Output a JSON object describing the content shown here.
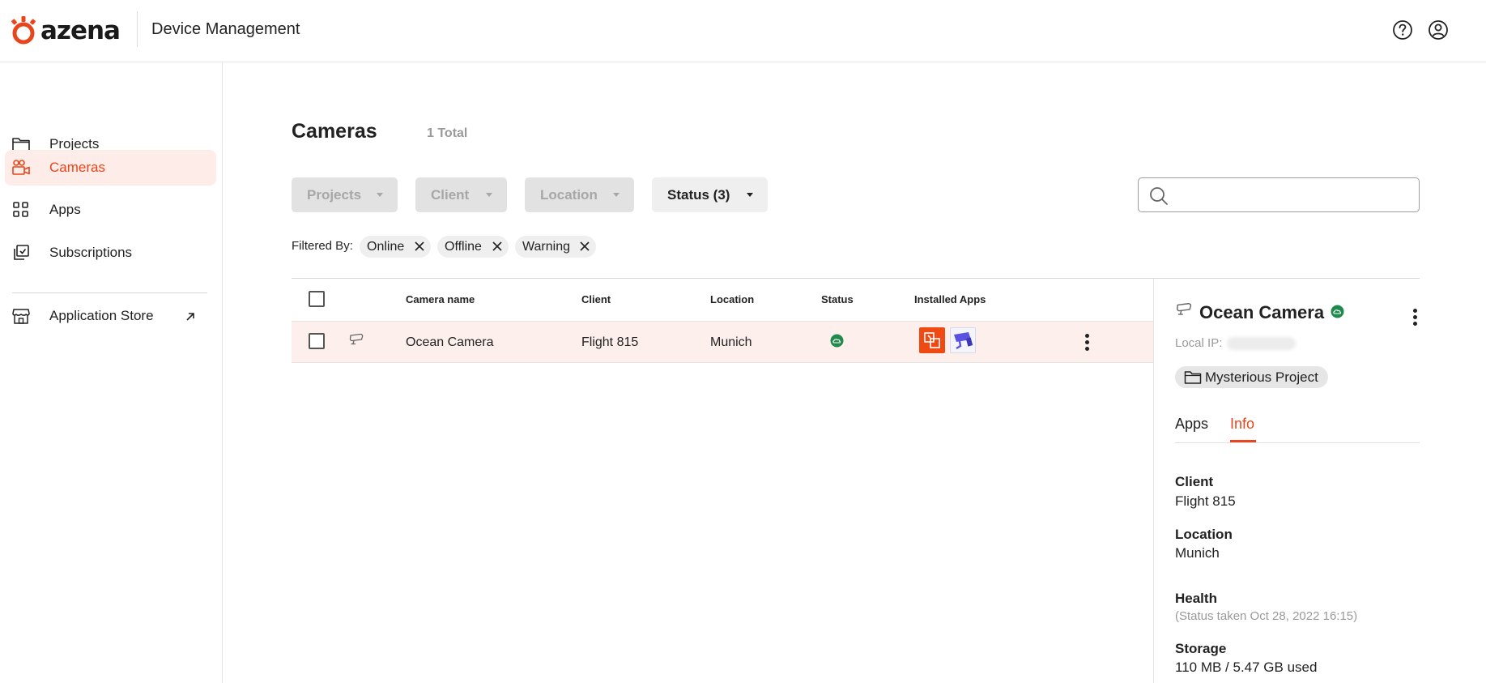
{
  "header": {
    "brand": "azena",
    "title": "Device Management",
    "help_icon": "help-circle-icon",
    "account_icon": "user-circle-icon"
  },
  "sidebar": {
    "items": [
      {
        "label": "Projects",
        "icon": "folder-icon",
        "active": false
      },
      {
        "label": "Cameras",
        "icon": "camera-icon",
        "active": true
      },
      {
        "label": "Apps",
        "icon": "grid-icon",
        "active": false
      },
      {
        "label": "Subscriptions",
        "icon": "subscriptions-icon",
        "active": false
      }
    ],
    "store": {
      "label": "Application Store",
      "icon": "store-icon",
      "external_icon": "external-arrow-icon"
    }
  },
  "main": {
    "title": "Cameras",
    "count": "1 Total",
    "filters": [
      {
        "label": "Projects",
        "enabled": false
      },
      {
        "label": "Client",
        "enabled": false
      },
      {
        "label": "Location",
        "enabled": false
      },
      {
        "label": "Status (3)",
        "enabled": true
      }
    ],
    "search": {
      "placeholder": "",
      "value": ""
    },
    "filtered_by": {
      "label": "Filtered By:",
      "chips": [
        "Online",
        "Offline",
        "Warning"
      ]
    },
    "table": {
      "columns": [
        "Camera name",
        "Client",
        "Location",
        "Status",
        "Installed Apps"
      ],
      "rows": [
        {
          "camera_name": "Ocean Camera",
          "client": "Flight 815",
          "location": "Munich",
          "status": "online",
          "installed_apps": [
            "orange-app-icon",
            "purple-camera-app-icon"
          ]
        }
      ]
    }
  },
  "detail": {
    "name": "Ocean Camera",
    "status": "online",
    "local_ip_label": "Local IP:",
    "project": "Mysterious Project",
    "tabs": [
      {
        "label": "Apps",
        "active": false
      },
      {
        "label": "Info",
        "active": true
      }
    ],
    "info": {
      "client_label": "Client",
      "client_value": "Flight 815",
      "location_label": "Location",
      "location_value": "Munich",
      "health_label": "Health",
      "health_sub": "(Status taken Oct 28, 2022 16:15)",
      "storage_label": "Storage",
      "storage_value": "110 MB / 5.47 GB used"
    }
  },
  "colors": {
    "accent": "#e8451c",
    "active_bg": "#fdece7",
    "online": "#1f8a4c",
    "app_purple": "#5b52e0"
  }
}
